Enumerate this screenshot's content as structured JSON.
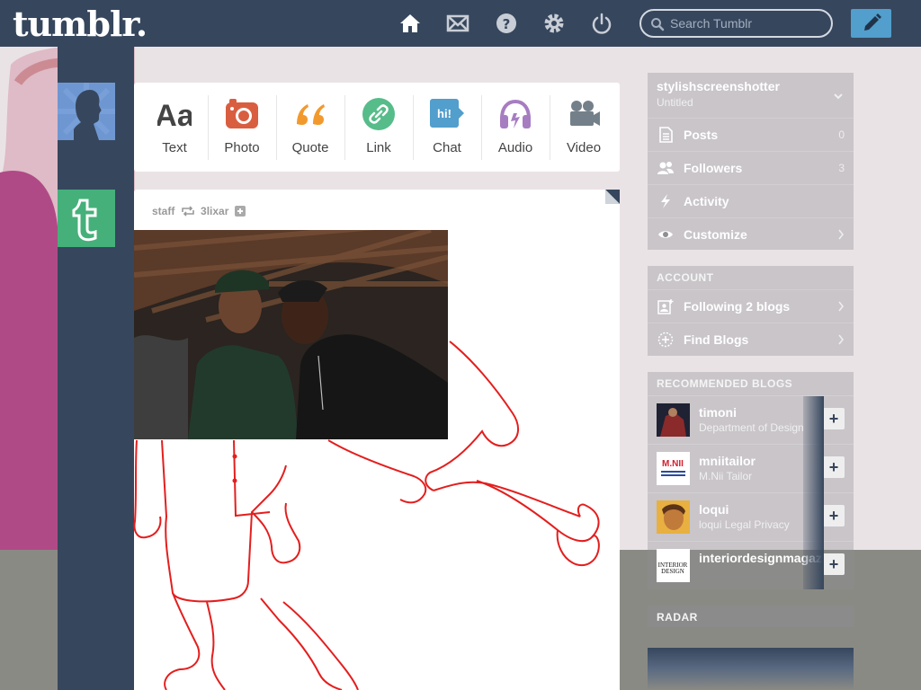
{
  "header": {
    "logo": "tumblr.",
    "nav_icons": [
      "home-icon",
      "mail-icon",
      "help-icon",
      "gear-icon",
      "power-icon"
    ],
    "search_placeholder": "Search Tumblr",
    "compose_icon": "pencil-icon"
  },
  "post_types": [
    {
      "label": "Text",
      "icon": "Aa",
      "color": "#444444"
    },
    {
      "label": "Photo",
      "icon": "camera-icon",
      "color": "#d95e40"
    },
    {
      "label": "Quote",
      "icon": "quote-icon",
      "color": "#f2992e"
    },
    {
      "label": "Link",
      "icon": "link-icon",
      "color": "#56bc8a"
    },
    {
      "label": "Chat",
      "icon": "hi!",
      "color": "#529ecc"
    },
    {
      "label": "Audio",
      "icon": "headphones-icon",
      "color": "#a77dc2"
    },
    {
      "label": "Video",
      "icon": "video-camera-icon",
      "color": "#748089"
    }
  ],
  "post": {
    "author": "staff",
    "reblogged_from": "3lixar"
  },
  "sidebar": {
    "blog_name": "stylishscreenshotter",
    "blog_title": "Untitled",
    "blog_items": [
      {
        "label": "Posts",
        "count": "0",
        "icon": "document-icon"
      },
      {
        "label": "Followers",
        "count": "3",
        "icon": "people-icon"
      },
      {
        "label": "Activity",
        "count": "",
        "icon": "lightning-icon"
      },
      {
        "label": "Customize",
        "count": "",
        "icon": "eye-icon"
      }
    ],
    "account_title": "ACCOUNT",
    "account_items": [
      {
        "label": "Following 2 blogs",
        "icon": "add-user-icon"
      },
      {
        "label": "Find Blogs",
        "icon": "compass-icon"
      }
    ],
    "recommended_title": "RECOMMENDED BLOGS",
    "recommended": [
      {
        "name": "timoni",
        "sub": "Department of Design"
      },
      {
        "name": "mniitailor",
        "sub": "M.Nii Tailor"
      },
      {
        "name": "loqui",
        "sub": "loqui   Legal   Privacy"
      },
      {
        "name": "interiordesignmagazine",
        "sub": ""
      }
    ],
    "radar_title": "RADAR"
  },
  "colors": {
    "header_bg": "#36465d",
    "accent_blue": "#529ecc",
    "tumblr_green": "#45b07a"
  }
}
